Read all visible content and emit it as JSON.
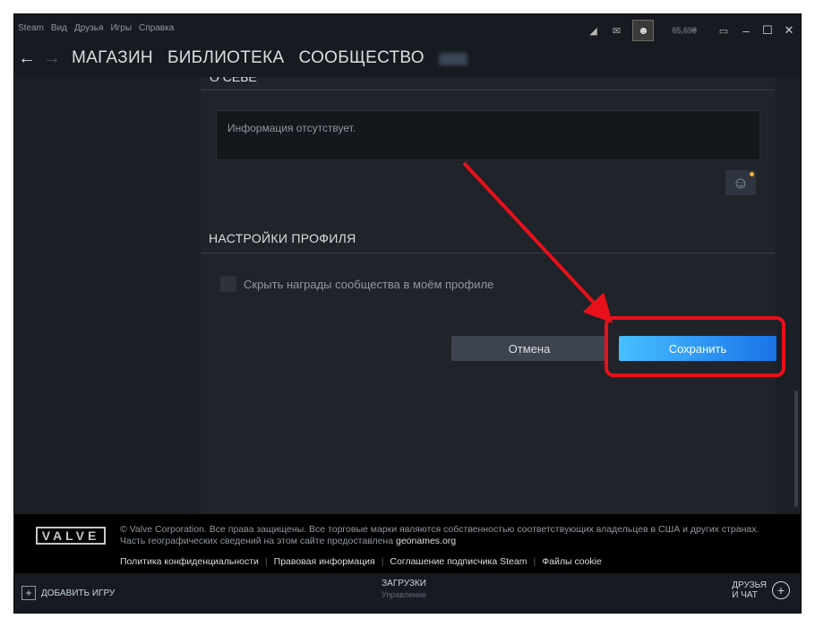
{
  "menu": [
    "Steam",
    "Вид",
    "Друзья",
    "Игры",
    "Справка"
  ],
  "titlebar": {
    "balance": "65,69₴"
  },
  "nav": {
    "back": "←",
    "forward": "→",
    "links": [
      "МАГАЗИН",
      "БИБЛИОТЕКА",
      "СООБЩЕСТВО"
    ]
  },
  "about": {
    "section_title": "О СЕБЕ",
    "placeholder": "Информация отсутствует."
  },
  "profile_settings": {
    "title": "НАСТРОЙКИ ПРОФИЛЯ",
    "checkbox_label": "Скрыть награды сообщества в моём профиле"
  },
  "buttons": {
    "cancel": "Отмена",
    "save": "Сохранить"
  },
  "footer": {
    "logo": "VALVE",
    "legal_line1": "© Valve Corporation. Все права защищены. Все торговые марки являются собственностью соответствующих владельцев в США и других странах.",
    "legal_line2_prefix": "Часть географических сведений на этом сайте предоставлена",
    "legal_line2_link": "geonames.org",
    "links": [
      "Политика конфиденциальности",
      "Правовая информация",
      "Соглашение подписчика Steam",
      "Файлы cookie"
    ]
  },
  "bottombar": {
    "add_game": "ДОБАВИТЬ ИГРУ",
    "downloads": "ЗАГРУЗКИ",
    "downloads_sub": "Управление",
    "friends_line1": "ДРУЗЬЯ",
    "friends_line2": "И ЧАТ"
  },
  "colors": {
    "highlight": "#e8101a",
    "save_button": "#1a73e8",
    "background": "#1b2838"
  }
}
